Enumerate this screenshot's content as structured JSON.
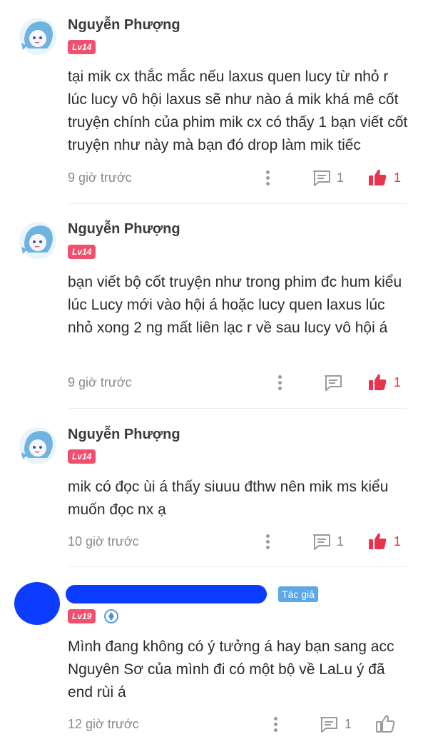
{
  "comments": [
    {
      "username": "Nguyễn Phượng",
      "level": "Lv14",
      "text": "tại mik cx thắc mắc nếu laxus quen lucy từ nhỏ r lúc lucy vô hội laxus sẽ như nào á mik khá mê cốt truyện chính của phim mik cx có thấy 1 bạn viết cốt truyện như này mà bạn đó drop làm mik tiếc",
      "time": "9 giờ trước",
      "replies": "1",
      "likes": "1"
    },
    {
      "username": "Nguyễn Phượng",
      "level": "Lv14",
      "text": "bạn viết bộ cốt truyện như trong phim đc hum kiểu lúc Lucy mới vào hội á hoặc lucy quen laxus lúc nhỏ xong 2 ng mất liên lạc r về sau lucy vô hội á",
      "time": "9 giờ trước",
      "replies": "",
      "likes": "1"
    },
    {
      "username": "Nguyễn Phượng",
      "level": "Lv14",
      "text": "mik có đọc ùi á thấy siuuu đthw nên mik ms kiểu muốn đọc nx ạ",
      "time": "10 giờ trước",
      "replies": "1",
      "likes": "1"
    },
    {
      "username": "",
      "author_badge": "Tác giả",
      "level": "Lv19",
      "text": "Mình đang không có ý tưởng á hay bạn sang acc Nguyên Sơ của mình đi có một bộ về LaLu ý đã end rùi á",
      "time": "12 giờ trước",
      "replies": "1",
      "likes": ""
    }
  ],
  "colors": {
    "like_active": "#e8334d",
    "level_badge": "#f0506e",
    "author_badge": "#5aa7ea",
    "redaction": "#0b3cff"
  },
  "icons": {
    "more": "more-vertical-icon",
    "reply": "comment-bubble-icon",
    "like": "thumbs-up-icon",
    "verified": "verified-badge-icon"
  }
}
